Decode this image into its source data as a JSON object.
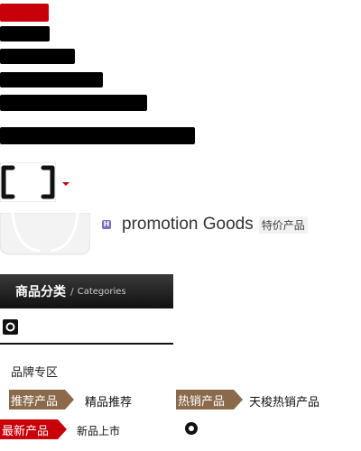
{
  "promotion": {
    "badge": "H",
    "title": "promotion Goods",
    "subtitle": "特价产品"
  },
  "categories": {
    "title": "商品分类",
    "slash": "/",
    "subtitle": "Categories"
  },
  "brand_zone": "品牌专区",
  "tags": {
    "recommend": "推荐产品",
    "hot": "热销产品",
    "new": "最新产品"
  },
  "links": {
    "boutique": "精品推荐",
    "hotsell": "天梭热销产品",
    "new_arrival": "新品上市"
  },
  "colors": {
    "accent_red": "#c8000a",
    "tag_brown": "#8a6a4a",
    "header_dark": "#1a1a1a"
  }
}
